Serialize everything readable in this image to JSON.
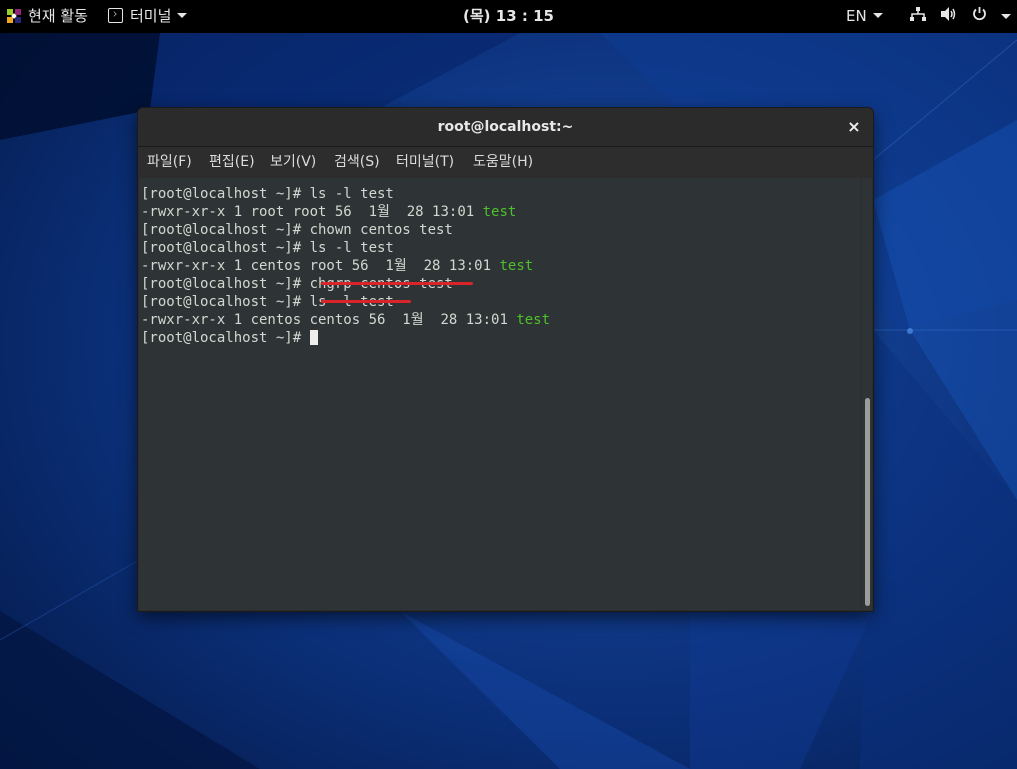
{
  "topbar": {
    "activities_label": "현재 활동",
    "app_menu_label": "터미널",
    "clock": "(목) 13 : 15",
    "lang": "EN"
  },
  "window": {
    "title": "root@localhost:~",
    "close_label": "×",
    "menus": [
      "파일(F)",
      "편집(E)",
      "보기(V)",
      "검색(S)",
      "터미널(T)",
      "도움말(H)"
    ]
  },
  "terminal": {
    "lines": [
      {
        "text": "[root@localhost ~]# ls -l test",
        "suffix": ""
      },
      {
        "text": "-rwxr-xr-x 1 root root 56  1월  28 13:01 ",
        "suffix": "test"
      },
      {
        "text": "[root@localhost ~]# chown centos test",
        "suffix": ""
      },
      {
        "text": "[root@localhost ~]# ls -l test",
        "suffix": ""
      },
      {
        "text": "-rwxr-xr-x 1 centos root 56  1월  28 13:01 ",
        "suffix": "test"
      },
      {
        "text": "[root@localhost ~]# chgrp centos test",
        "suffix": ""
      },
      {
        "text": "[root@localhost ~]# ls -l test",
        "suffix": ""
      },
      {
        "text": "-rwxr-xr-x 1 centos centos 56  1월  28 13:01 ",
        "suffix": "test"
      },
      {
        "text": "[root@localhost ~]# ",
        "suffix": ""
      }
    ]
  },
  "colors": {
    "filename_green": "#4ec12a",
    "annotation_red": "#d9242a",
    "terminal_bg": "#2e3436"
  }
}
